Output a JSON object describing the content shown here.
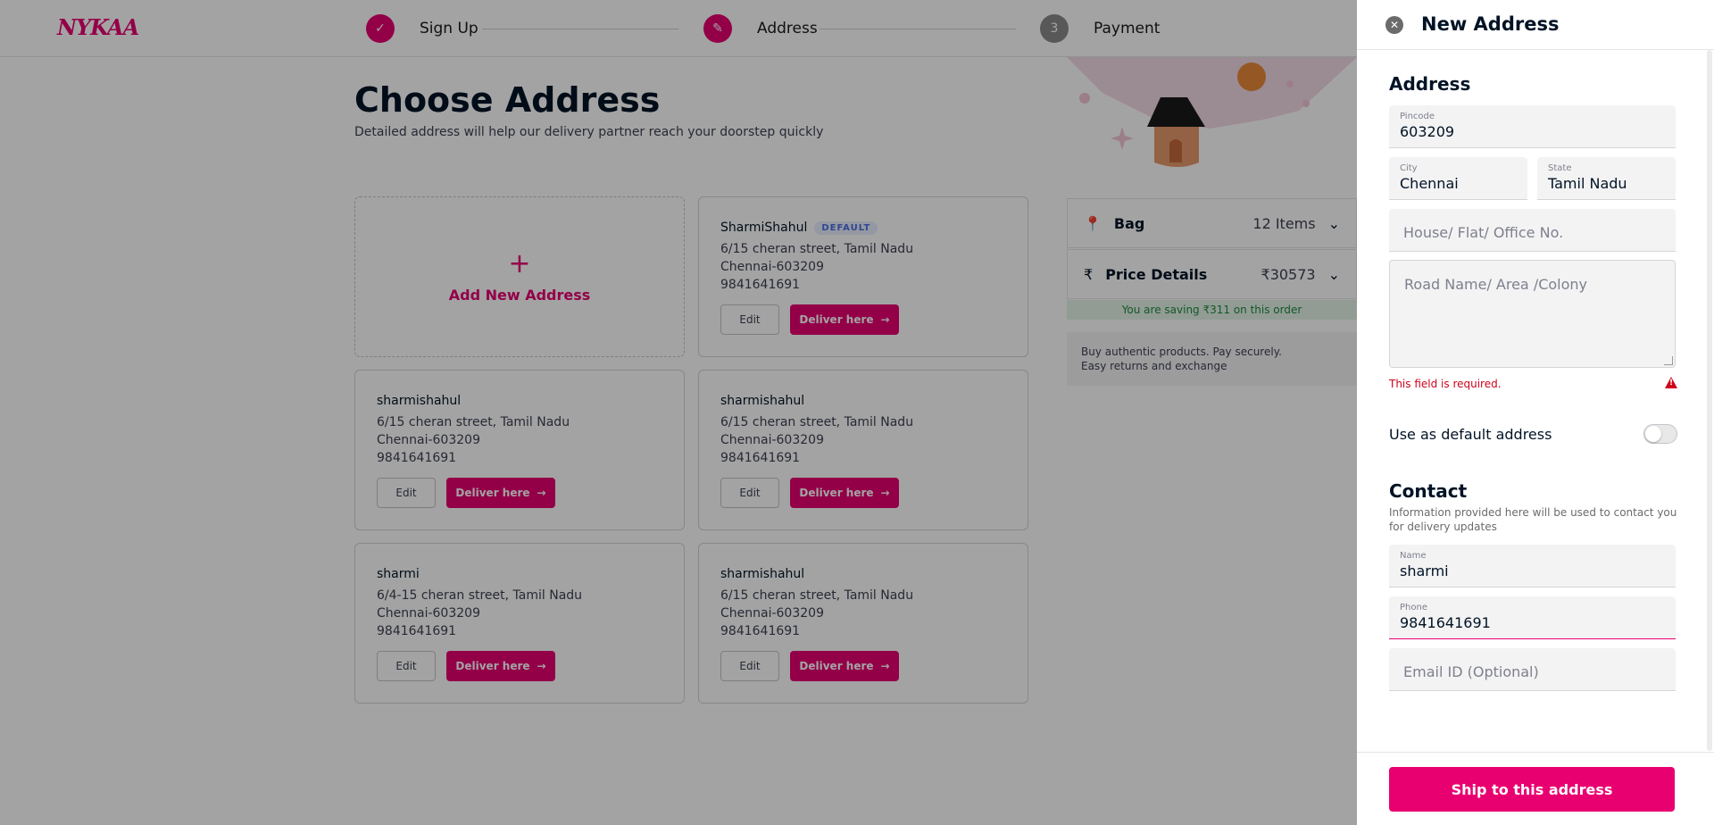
{
  "brand": {
    "logo_text": "NYKAA",
    "accent": "#e80071"
  },
  "steps": [
    {
      "label": "Sign Up",
      "icon": "check-icon",
      "state": "done"
    },
    {
      "label": "Address",
      "icon": "pencil-icon",
      "state": "active"
    },
    {
      "label": "Payment",
      "number": "3",
      "state": "pending"
    }
  ],
  "page": {
    "title": "Choose Address",
    "subtitle": "Detailed address will help our delivery partner reach your doorstep quickly"
  },
  "add_card": {
    "plus": "+",
    "label": "Add New Address"
  },
  "addresses": [
    {
      "name": "SharmiShahul",
      "badge": "DEFAULT",
      "line1": "6/15 cheran street, Tamil Nadu",
      "line2": "Chennai-603209",
      "phone": "9841641691",
      "edit_label": "Edit",
      "deliver_label": "Deliver here"
    },
    {
      "name": "sharmishahul",
      "line1": "6/15 cheran street, Tamil Nadu",
      "line2": "Chennai-603209",
      "phone": "9841641691",
      "edit_label": "Edit",
      "deliver_label": "Deliver here"
    },
    {
      "name": "sharmishahul",
      "line1": "6/15 cheran street, Tamil Nadu",
      "line2": "Chennai-603209",
      "phone": "9841641691",
      "edit_label": "Edit",
      "deliver_label": "Deliver here"
    },
    {
      "name": "sharmi",
      "line1": "6/4-15 cheran street, Tamil Nadu",
      "line2": "Chennai-603209",
      "phone": "9841641691",
      "edit_label": "Edit",
      "deliver_label": "Deliver here"
    },
    {
      "name": "sharmishahul",
      "line1": "6/15 cheran street, Tamil Nadu",
      "line2": "Chennai-603209",
      "phone": "9841641691",
      "edit_label": "Edit",
      "deliver_label": "Deliver here"
    }
  ],
  "summary": {
    "bag": {
      "label": "Bag",
      "value": "12 Items"
    },
    "price": {
      "label": "Price Details",
      "value": "₹30573"
    },
    "saving": "You are saving ₹311 on this order",
    "trust_line1": "Buy authentic products. Pay securely.",
    "trust_line2": "Easy returns and exchange"
  },
  "drawer": {
    "title": "New Address",
    "address_section": "Address",
    "pincode": {
      "label": "Pincode",
      "value": "603209"
    },
    "city": {
      "label": "City",
      "value": "Chennai"
    },
    "state": {
      "label": "State",
      "value": "Tamil Nadu"
    },
    "house_placeholder": "House/ Flat/ Office No.",
    "road_placeholder": "Road Name/ Area /Colony",
    "error": "This field is required.",
    "default_toggle_label": "Use as default address",
    "default_toggle_on": false,
    "contact_section": "Contact",
    "contact_desc": "Information provided here will be used to contact you for delivery updates",
    "name": {
      "label": "Name",
      "value": "sharmi"
    },
    "phone": {
      "label": "Phone",
      "value": "9841641691"
    },
    "email_placeholder": "Email ID (Optional)",
    "submit_label": "Ship to this address"
  }
}
